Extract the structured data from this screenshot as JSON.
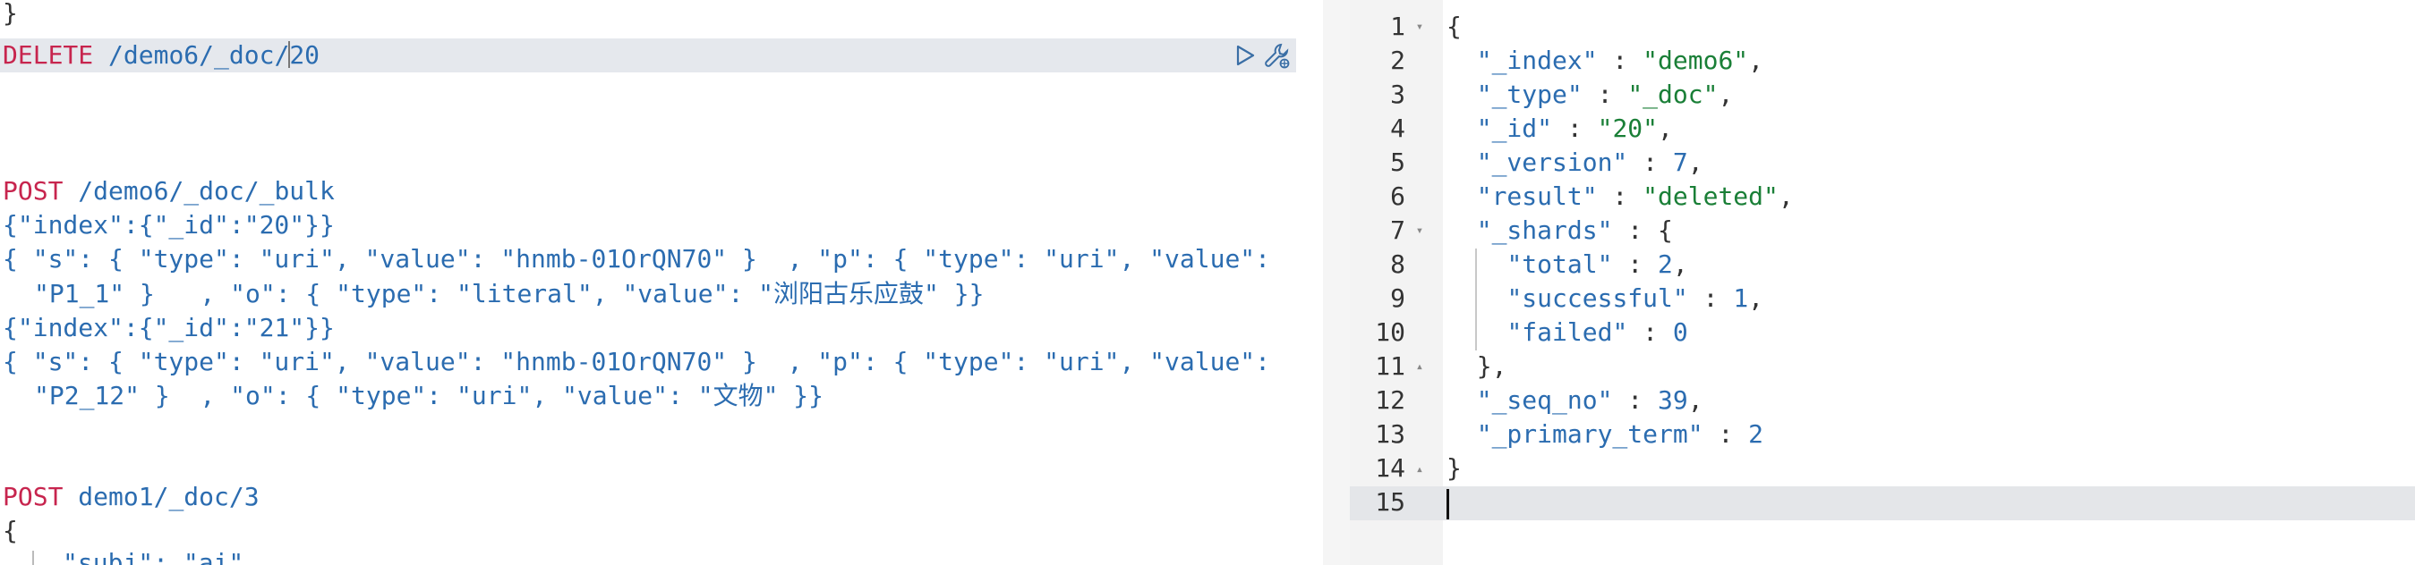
{
  "left": {
    "lines": {
      "l0": "}",
      "delete_method": "DELETE",
      "delete_path_a": "/demo6/_doc/",
      "delete_path_b": "20",
      "post1_method": "POST",
      "post1_path": "/demo6/_doc/_bulk",
      "l4": "{\"index\":{\"_id\":\"20\"}}",
      "l5": "{ \"s\": { \"type\": \"uri\", \"value\": \"hnmb-01OrQN70\" }  , \"p\": { \"type\": \"uri\", \"value\":",
      "l6": "\"P1_1\" }   , \"o\": { \"type\": \"literal\", \"value\": \"浏阳古乐应鼓\" }}",
      "l7": "{\"index\":{\"_id\":\"21\"}}",
      "l8": "{ \"s\": { \"type\": \"uri\", \"value\": \"hnmb-01OrQN70\" }  , \"p\": { \"type\": \"uri\", \"value\":",
      "l9": "\"P2_12\" }  , \"o\": { \"type\": \"uri\", \"value\": \"文物\" }}",
      "post2_method": "POST",
      "post2_path": "demo1/_doc/3",
      "l11": "{",
      "l12": "\"subj\": \"ai\""
    },
    "icons": {
      "run": "play-icon",
      "settings": "wrench-icon"
    }
  },
  "right": {
    "line_numbers": [
      "1",
      "2",
      "3",
      "4",
      "5",
      "6",
      "7",
      "8",
      "9",
      "10",
      "11",
      "12",
      "13",
      "14",
      "15"
    ],
    "lines": [
      "{",
      "  \"_index\" : \"demo6\",",
      "  \"_type\" : \"_doc\",",
      "  \"_id\" : \"20\",",
      "  \"_version\" : 7,",
      "  \"result\" : \"deleted\",",
      "  \"_shards\" : {",
      "    \"total\" : 2,",
      "    \"successful\" : 1,",
      "    \"failed\" : 0",
      "  },",
      "  \"_seq_no\" : 39,",
      "  \"_primary_term\" : 2",
      "}",
      ""
    ]
  },
  "colors": {
    "method": "#c7254e",
    "string": "#1a7f37",
    "key": "#2b6cb0",
    "highlight_row": "#e5e8ed"
  }
}
